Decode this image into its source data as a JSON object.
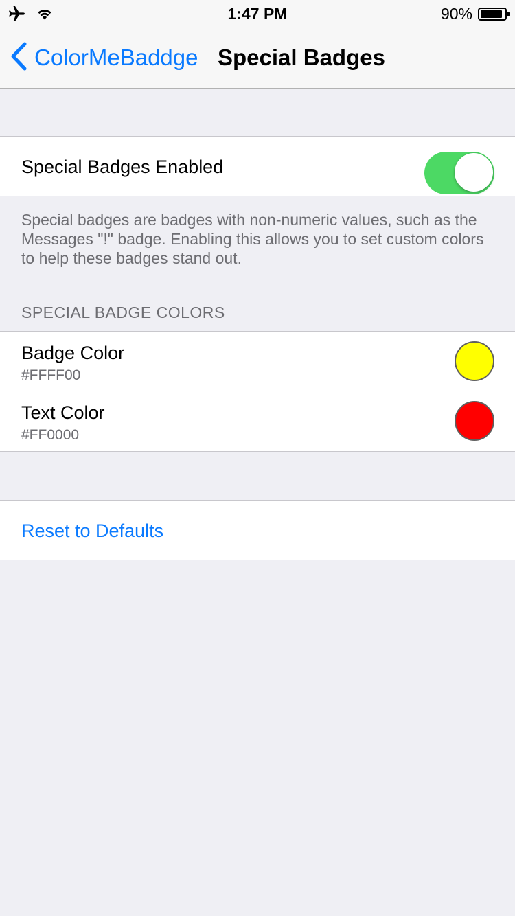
{
  "status_bar": {
    "time": "1:47 PM",
    "battery": "90%",
    "battery_level": 0.9,
    "icons": [
      "airplane-icon",
      "wifi-icon",
      "battery-icon"
    ]
  },
  "nav": {
    "back_label": "ColorMeBaddge",
    "title": "Special Badges",
    "accent_color": "#0A7AFF"
  },
  "toggle_section": {
    "label": "Special Badges Enabled",
    "enabled": true,
    "footer": "Special badges are badges with non-numeric values, such as the Messages \"!\" badge.  Enabling this allows you to set custom colors to help these badges stand out."
  },
  "colors_section": {
    "header": "SPECIAL BADGE COLORS",
    "items": [
      {
        "title": "Badge Color",
        "value": "#FFFF00",
        "swatch": "#FFFF00"
      },
      {
        "title": "Text Color",
        "value": "#FF0000",
        "swatch": "#FF0000"
      }
    ]
  },
  "reset": {
    "label": "Reset to Defaults"
  }
}
